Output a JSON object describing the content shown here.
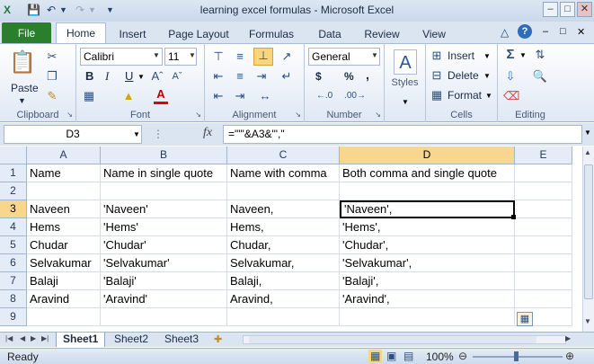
{
  "window": {
    "title": "learning excel formulas  -  Microsoft Excel",
    "minimize_icon": "minimize-icon",
    "restore_icon": "restore-icon",
    "close_icon": "close-icon"
  },
  "quick_access": {
    "save": "save-icon",
    "undo": "undo-icon",
    "redo": "redo-icon",
    "customize": "customize-icon"
  },
  "tabs": [
    "File",
    "Home",
    "Insert",
    "Page Layout",
    "Formulas",
    "Data",
    "Review",
    "View"
  ],
  "ribbon": {
    "clipboard": {
      "paste": "Paste",
      "label": "Clipboard"
    },
    "font": {
      "name": "Calibri",
      "size": "11",
      "bold": "B",
      "italic": "I",
      "underline": "U",
      "label": "Font"
    },
    "alignment": {
      "label": "Alignment"
    },
    "number": {
      "format": "General",
      "currency": "$",
      "percent": "%",
      "comma": ",",
      "label": "Number"
    },
    "styles": {
      "label": "Styles"
    },
    "cells": {
      "insert": "Insert",
      "delete": "Delete",
      "format": "Format",
      "label": "Cells"
    },
    "editing": {
      "label": "Editing"
    }
  },
  "formula_bar": {
    "name_box": "D3",
    "fx": "fx",
    "formula": "=\"'\"&A3&\"',\""
  },
  "columns": [
    "A",
    "B",
    "C",
    "D",
    "E"
  ],
  "rows": [
    {
      "num": "1",
      "cells": [
        "Name",
        "Name in single quote",
        "Name with comma",
        "Both comma and single quote",
        ""
      ]
    },
    {
      "num": "2",
      "cells": [
        "",
        "",
        "",
        "",
        ""
      ]
    },
    {
      "num": "3",
      "cells": [
        "Naveen",
        "'Naveen'",
        "Naveen,",
        "'Naveen',",
        ""
      ]
    },
    {
      "num": "4",
      "cells": [
        "Hems",
        "'Hems'",
        "Hems,",
        "'Hems',",
        ""
      ]
    },
    {
      "num": "5",
      "cells": [
        "Chudar",
        "'Chudar'",
        "Chudar,",
        "'Chudar',",
        ""
      ]
    },
    {
      "num": "6",
      "cells": [
        "Selvakumar",
        "'Selvakumar'",
        "Selvakumar,",
        "'Selvakumar',",
        ""
      ]
    },
    {
      "num": "7",
      "cells": [
        "Balaji",
        "'Balaji'",
        "Balaji,",
        "'Balaji',",
        ""
      ]
    },
    {
      "num": "8",
      "cells": [
        "Aravind",
        "'Aravind'",
        "Aravind,",
        "'Aravind',",
        ""
      ]
    },
    {
      "num": "9",
      "cells": [
        "",
        "",
        "",
        "",
        ""
      ]
    }
  ],
  "sheets": [
    "Sheet1",
    "Sheet2",
    "Sheet3"
  ],
  "status": {
    "ready": "Ready",
    "zoom": "100%"
  }
}
